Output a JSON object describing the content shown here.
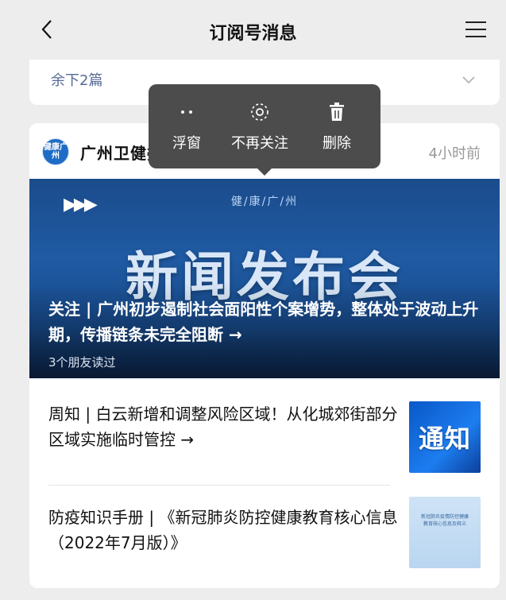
{
  "header": {
    "title": "订阅号消息"
  },
  "collapsed_card": {
    "remain_label": "余下2篇"
  },
  "article_card": {
    "account": {
      "avatar_text": "健康广州",
      "name": "广州卫健委"
    },
    "time": "4小时前",
    "banner": {
      "tag": "健/康/广/州",
      "big_text": "新闻发布会",
      "headline": "关注 | 广州初步遏制社会面阳性个案增势，整体处于波动上升期，传播链条未完全阻断 →",
      "friends_read": "3个朋友读过"
    },
    "items": [
      {
        "title": "周知 | 白云新增和调整风险区域！从化城郊街部分区域实施临时管控 →",
        "thumb_text": "通知"
      },
      {
        "title": "防疫知识手册 | 《新冠肺炎防控健康教育核心信息（2022年7月版）》",
        "thumb_text_1": "新冠肺炎疫情防控健康",
        "thumb_text_2": "教育核心信息及释义"
      }
    ]
  },
  "popup_menu": {
    "items": [
      {
        "label": "浮窗",
        "icon": "float-window-icon"
      },
      {
        "label": "不再关注",
        "icon": "unfollow-icon"
      },
      {
        "label": "删除",
        "icon": "trash-icon"
      }
    ]
  },
  "colors": {
    "background": "#ededed",
    "link_blue": "#576b95",
    "popup_bg": "#4c4c4c",
    "banner_blue": "#1f5aa3"
  }
}
